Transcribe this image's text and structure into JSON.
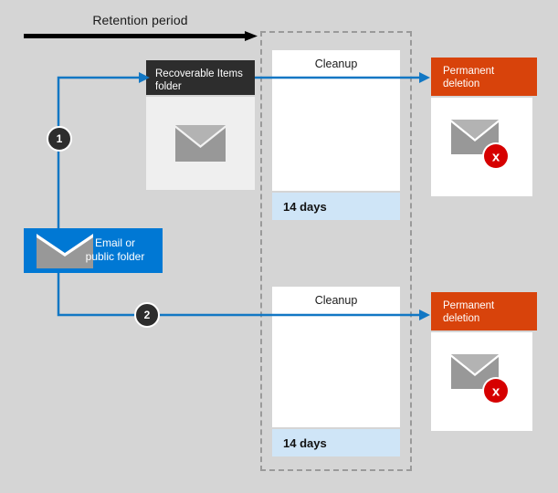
{
  "diagram": {
    "title": "Retention period",
    "background_color": "#d5d5d5"
  },
  "colors": {
    "accent_blue": "#0078d4",
    "permanent_deletion_orange": "#d8430b",
    "dark_header": "#2d2d2d",
    "days_badge_blue": "#cfe5f7",
    "envelope_gray": "#989898",
    "delete_red": "#d60000",
    "arrow_black": "#000000"
  },
  "header": {
    "label": "Retention period",
    "arrow_icon": "right-arrow-icon"
  },
  "source": {
    "label": "Email or\npublic folder",
    "label_line1": "Email or",
    "label_line2": "public folder",
    "icon": "envelope-icon"
  },
  "steps": [
    {
      "number": "1"
    },
    {
      "number": "2"
    }
  ],
  "recoverable_items": {
    "header_label": "Recoverable Items folder",
    "header_line1": "Recoverable Items",
    "header_line2": "folder",
    "icon": "envelope-icon"
  },
  "cleanup_group": {
    "border_style": "dashed",
    "branches": [
      {
        "id": "top",
        "cleanup_label": "Cleanup",
        "days_label": "14 days"
      },
      {
        "id": "bottom",
        "cleanup_label": "Cleanup",
        "days_label": "14 days"
      }
    ]
  },
  "permanent_deletion": [
    {
      "id": "top",
      "header_label": "Permanent deletion",
      "header_line1": "Permanent",
      "header_line2": "deletion",
      "icon": "envelope-deleted-icon",
      "badge_icon": "x-circle-icon",
      "badge_glyph": "x"
    },
    {
      "id": "bottom",
      "header_label": "Permanent deletion",
      "header_line1": "Permanent",
      "header_line2": "deletion",
      "icon": "envelope-deleted-icon",
      "badge_icon": "x-circle-icon",
      "badge_glyph": "x"
    }
  ]
}
